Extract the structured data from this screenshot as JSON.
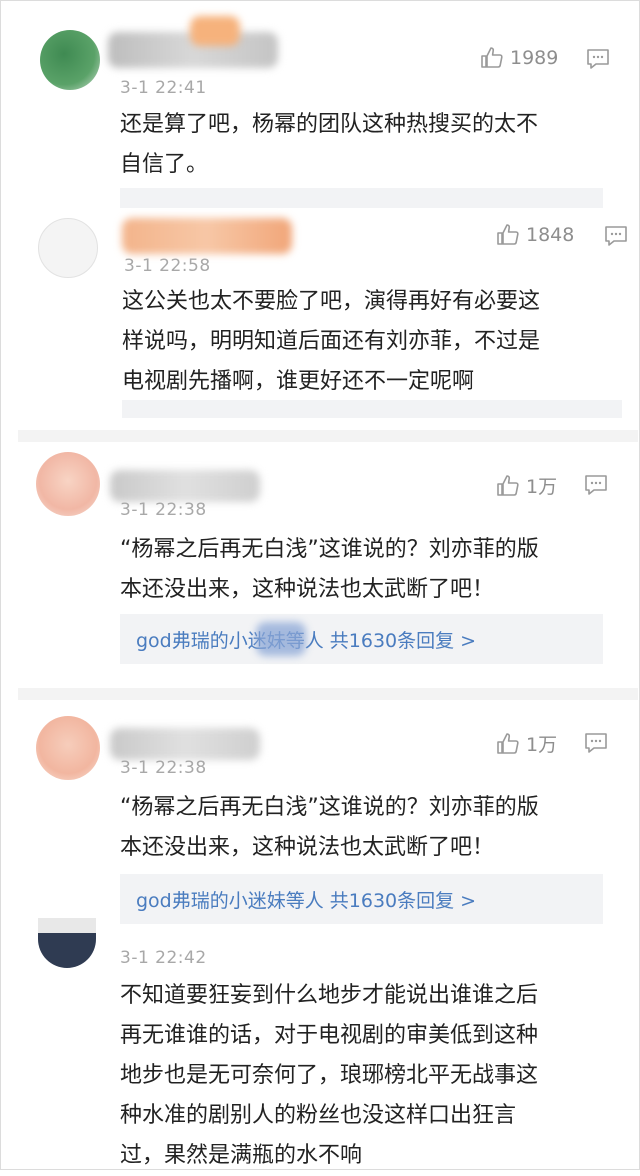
{
  "comments": [
    {
      "likes": "1989",
      "time": "3-1 22:41",
      "text_lines": [
        "还是算了吧，杨幂的团队这种热搜买的太不",
        "自信了。"
      ]
    },
    {
      "likes": "1848",
      "time": "3-1 22:58",
      "text_lines": [
        "这公关也太不要脸了吧，演得再好有必要这",
        "样说吗，明明知道后面还有刘亦菲，不过是",
        "电视剧先播啊，谁更好还不一定呢啊"
      ]
    },
    {
      "likes": "1万",
      "time": "3-1 22:38",
      "text_lines": [
        "“杨幂之后再无白浅”这谁说的？刘亦菲的版",
        "本还没出来，这种说法也太武断了吧！"
      ],
      "replies": "god弗瑞的小迷妹等人  共1630条回复 >"
    },
    {
      "likes": "1万",
      "time": "3-1 22:38",
      "text_lines": [
        "“杨幂之后再无白浅”这谁说的？刘亦菲的版",
        "本还没出来，这种说法也太武断了吧！"
      ],
      "replies": "god弗瑞的小迷妹等人  共1630条回复 >"
    },
    {
      "time": "3-1 22:42",
      "text_lines": [
        "不知道要狂妄到什么地步才能说出谁谁之后",
        "再无谁谁的话，对于电视剧的审美低到这种",
        "地步也是无可奈何了，琅琊榜北平无战事这",
        "种水准的剧别人的粉丝也没这样口出狂言",
        "过，果然是满瓶的水不响"
      ]
    }
  ],
  "colors": {
    "link": "#4a7cbf",
    "time": "#a8a8a8",
    "reply_bg": "#f2f3f5"
  },
  "icons": {
    "like": "thumbs-up-icon",
    "reply": "comment-bubble-icon"
  }
}
